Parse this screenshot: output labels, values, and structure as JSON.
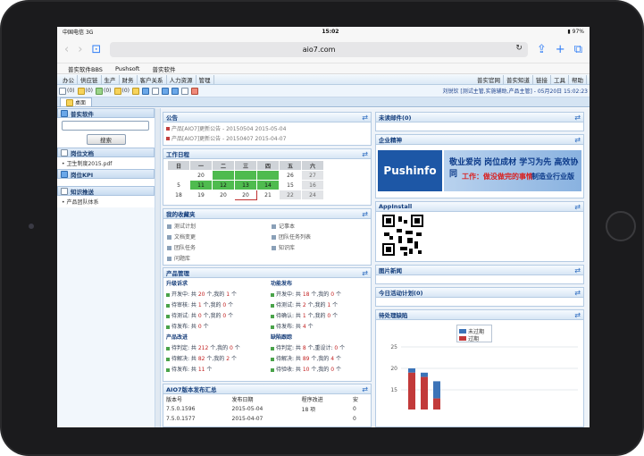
{
  "statusbar": {
    "carrier": "中国电信",
    "network": "3G",
    "time": "15:02",
    "battery": "97%"
  },
  "browser": {
    "url": "aio7.com"
  },
  "bookmarks": [
    "普实软件BBS",
    "Pushsoft",
    "普实软件"
  ],
  "menu": {
    "left": [
      "办公",
      "供应链",
      "生产",
      "财务",
      "客户关系",
      "人力资源",
      "管理"
    ],
    "right": [
      "普实官网",
      "普实知道",
      "链接",
      "工具",
      "帮助"
    ]
  },
  "toolbar": {
    "counts": [
      "(0)",
      "(0)",
      "(0)",
      "(0)"
    ],
    "user": "刘锐钦 [测试主管,实施辅助,产品主管] - 05月20日 15:02:23"
  },
  "tabs": {
    "desktop": "桌面"
  },
  "left": {
    "soft_title": "普实软件",
    "search_btn": "搜索",
    "doc_title": "岗位文档",
    "doc_items": [
      "卫生制度2015.pdf"
    ],
    "kpi_title": "岗位KPI",
    "know_title": "知识推送",
    "know_items": [
      "产品团队体系"
    ]
  },
  "notice": {
    "title": "公告",
    "items": [
      {
        "text": "产品[AIO7]更新公告 - 20150504",
        "date": "2015-05-04"
      },
      {
        "text": "产品[AIO7]更新公告 - 20150407",
        "date": "2015-04-07"
      }
    ]
  },
  "schedule": {
    "title": "工作日程",
    "head": [
      "日",
      "一",
      "二",
      "三",
      "四",
      "五",
      "六"
    ],
    "weeks": [
      [
        "",
        "20",
        "",
        "",
        "",
        "26",
        "27"
      ],
      [
        "5",
        "11",
        "12",
        "13",
        "14",
        "15",
        "16"
      ],
      [
        "",
        "18",
        "19",
        "20",
        "21",
        "22",
        "23",
        "24"
      ]
    ]
  },
  "calendar": {
    "row0": [
      "",
      "",
      "",
      "",
      "",
      "",
      ""
    ],
    "r1": [
      " ",
      "20",
      "",
      "",
      "",
      "26",
      "27"
    ],
    "r2": [
      "5",
      "11",
      "12",
      "13",
      "14",
      "15",
      "16"
    ],
    "r3": [
      "",
      "18",
      "19",
      "20",
      "21",
      "22",
      "23",
      "24"
    ]
  },
  "favorites": {
    "title": "我的收藏夹",
    "items": [
      "测试计划",
      "记事本",
      "文档变更",
      "团队任务列表",
      "团队任务",
      "知识库",
      "问题库"
    ]
  },
  "product": {
    "title": "产品管理",
    "groups": [
      {
        "title": "升级诉求",
        "items": [
          [
            "开发中: 共 ",
            "20",
            " 个,我的 ",
            "1",
            " 个"
          ],
          [
            "待审核: 共 ",
            "1",
            " 个,我的 ",
            "0",
            " 个"
          ],
          [
            "待测试: 共 ",
            "0",
            " 个,我的 ",
            "0",
            " 个"
          ],
          [
            "待发布: 共 ",
            "0",
            " 个",
            "",
            ""
          ]
        ]
      },
      {
        "title": "功能发布",
        "items": [
          [
            "开发中: 共 ",
            "18",
            " 个,我的 ",
            "0",
            " 个"
          ],
          [
            "待测试: 共 ",
            "2",
            " 个,我的 ",
            "1",
            " 个"
          ],
          [
            "待确认: 共 ",
            "1",
            " 个,我的 ",
            "0",
            " 个"
          ],
          [
            "待发布: 共 ",
            "4",
            " 个",
            "",
            ""
          ]
        ]
      },
      {
        "title": "产品改进",
        "items": [
          [
            "待判定: 共 ",
            "212",
            " 个,我的 ",
            "0",
            " 个"
          ],
          [
            "待解决: 共 ",
            "82",
            " 个,我的 ",
            "2",
            " 个"
          ],
          [
            "待发布: 共 ",
            "11",
            " 个",
            "",
            ""
          ]
        ]
      },
      {
        "title": "缺陷跟踪",
        "items": [
          [
            "待判定: 共 ",
            "8",
            " 个,重设计: ",
            "0",
            " 个"
          ],
          [
            "待解决: 共 ",
            "89",
            " 个,我的 ",
            "4",
            " 个"
          ],
          [
            "待验收: 共 ",
            "10",
            " 个,我的 ",
            "0",
            " 个"
          ]
        ]
      }
    ]
  },
  "release": {
    "title": "AIO7版本发布汇总",
    "head": [
      "版本号",
      "发布日期",
      "程序改进",
      "安"
    ],
    "rows": [
      [
        "7.5.0.1596",
        "2015-05-04",
        "18 项",
        "0"
      ],
      [
        "7.5.0.1577",
        "2015-04-07",
        "",
        "0"
      ]
    ]
  },
  "right": {
    "unread": "未读邮件(0)",
    "spirit": "企业精神",
    "banner": {
      "logo": "Pushinfo",
      "line1": "敬业爱岗  岗位成材  学习为先  高效协同",
      "line2": "工作：做没做完的事情",
      "line3": "制造业行业版"
    },
    "app": "AppInstall",
    "news": "图片新闻",
    "plan": "今日活动计划(0)",
    "pending": "待处理缺陷"
  },
  "chart_data": {
    "type": "bar",
    "series": [
      {
        "name": "未过期",
        "color": "#3b73b8",
        "values": [
          1,
          1,
          4
        ]
      },
      {
        "name": "过期",
        "color": "#c23a3a",
        "values": [
          19,
          18,
          13
        ]
      }
    ],
    "ylim": [
      0,
      25
    ],
    "yticks": [
      "25",
      "20",
      "15"
    ]
  }
}
